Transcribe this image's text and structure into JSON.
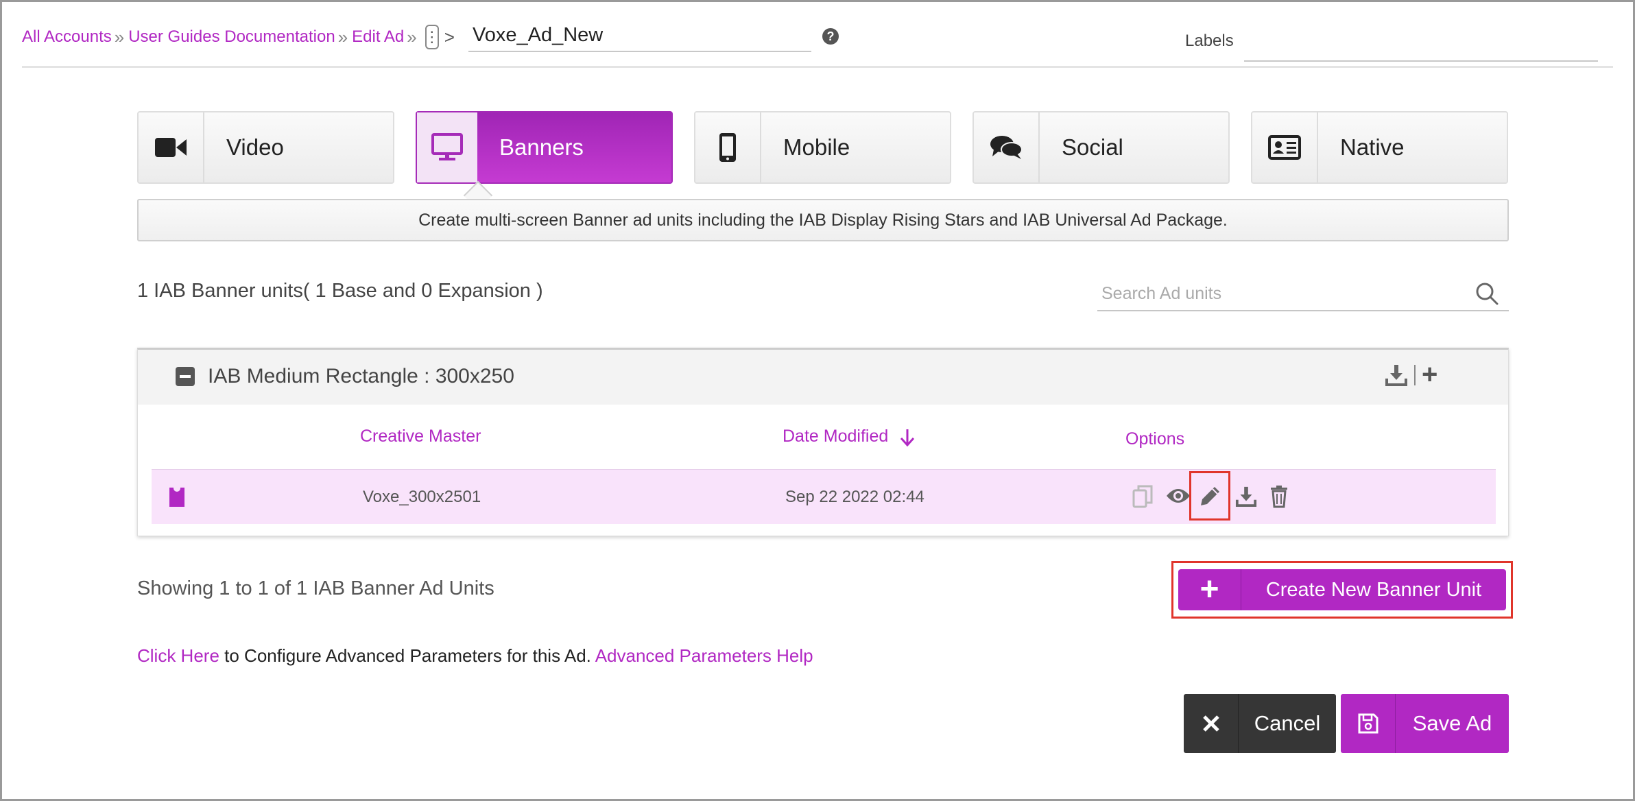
{
  "breadcrumb": {
    "items": [
      "All Accounts",
      "User Guides Documentation",
      "Edit Ad"
    ],
    "separator": "»",
    "kebab": "⋮",
    "arrow": ">"
  },
  "ad": {
    "name": "Voxe_Ad_New"
  },
  "labels": {
    "label": "Labels",
    "value": ""
  },
  "tabs": [
    {
      "label": "Video",
      "icon": "video-camera-icon",
      "active": false
    },
    {
      "label": "Banners",
      "icon": "monitor-icon",
      "active": true
    },
    {
      "label": "Mobile",
      "icon": "mobile-phone-icon",
      "active": false
    },
    {
      "label": "Social",
      "icon": "chat-bubbles-icon",
      "active": false
    },
    {
      "label": "Native",
      "icon": "id-card-icon",
      "active": false
    }
  ],
  "description": "Create multi-screen Banner ad units including the IAB Display Rising Stars and IAB Universal Ad Package.",
  "units": {
    "summary": "1 IAB Banner units( 1 Base and 0 Expansion )",
    "search_placeholder": "Search Ad units"
  },
  "panel": {
    "title": "IAB Medium Rectangle : 300x250",
    "columns": {
      "creative": "Creative Master",
      "date": "Date Modified",
      "options": "Options"
    },
    "rows": [
      {
        "creative": "Voxe_300x2501",
        "date": "Sep 22 2022 02:44"
      }
    ]
  },
  "footer": {
    "showing": "Showing 1 to 1 of 1 IAB Banner Ad Units",
    "create_label": "Create New Banner Unit",
    "create_plus": "+",
    "advanced": {
      "link1": "Click Here",
      "text": " to Configure Advanced Parameters for this Ad. ",
      "link2": "Advanced Parameters Help"
    }
  },
  "actions": {
    "cancel": "Cancel",
    "save": "Save Ad"
  },
  "colors": {
    "accent": "#b128c3",
    "highlight": "#e0352b",
    "dark": "#363636",
    "row_bg": "#f9e3fb"
  }
}
